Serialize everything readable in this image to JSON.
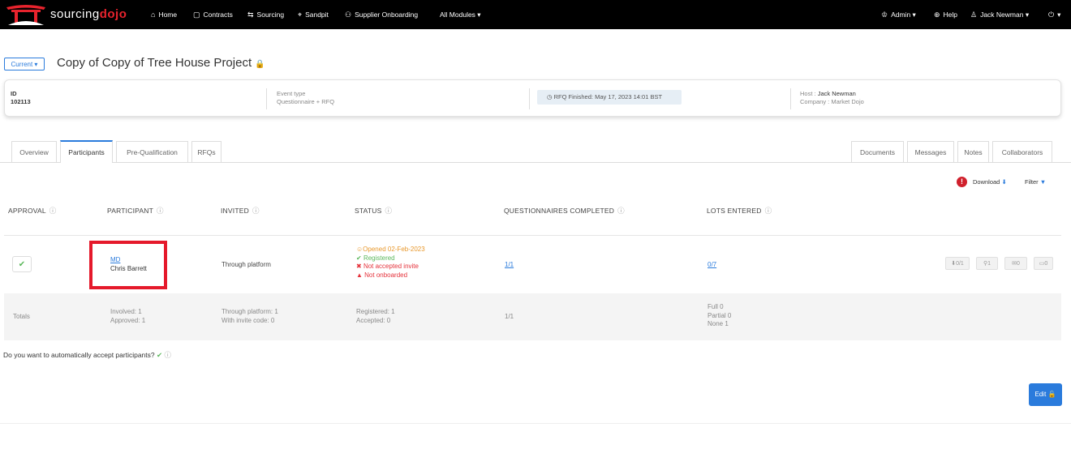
{
  "brand": {
    "part1": "sourcing",
    "part2": "dojo"
  },
  "nav": {
    "items": [
      {
        "icon": "home-icon",
        "glyph": "⌂",
        "label": "Home"
      },
      {
        "icon": "contracts-icon",
        "glyph": "▢",
        "label": "Contracts"
      },
      {
        "icon": "sourcing-icon",
        "glyph": "⇆",
        "label": "Sourcing"
      },
      {
        "icon": "sandpit-icon",
        "glyph": "⌖",
        "label": "Sandpit"
      },
      {
        "icon": "supplier-onboarding-icon",
        "glyph": "⚇",
        "label": "Supplier Onboarding"
      }
    ],
    "all_modules": "All Modules ▾",
    "admin": "Admin ▾",
    "help": "Help",
    "user": "Jack Newman ▾",
    "power": "▾"
  },
  "header": {
    "current_btn": "Current ▾",
    "title": "Copy of Copy of Tree House Project"
  },
  "info": {
    "id_label": "ID",
    "id_value": "102113",
    "event_type_label": "Event type",
    "event_type_value": "Questionnaire + RFQ",
    "rfq_status": "RFQ Finished: May 17, 2023 14:01 BST",
    "host_label": "Host : ",
    "host_value": "Jack Newman",
    "company_label": "Company : Market Dojo"
  },
  "tabs_left": [
    "Overview",
    "Participants",
    "Pre-Qualification",
    "RFQs"
  ],
  "tabs_right": [
    "Documents",
    "Messages",
    "Notes",
    "Collaborators"
  ],
  "toolbar": {
    "alert": "!",
    "download": "Download",
    "filter": "Filter"
  },
  "table": {
    "headers": [
      "APPROVAL",
      "PARTICIPANT",
      "INVITED",
      "STATUS",
      "QUESTIONNAIRES COMPLETED",
      "LOTS ENTERED"
    ],
    "row": {
      "participant_code": "MD",
      "participant_name": "Chris Barrett",
      "invited": "Through platform",
      "status": {
        "opened": "Opened 02-Feb-2023",
        "registered": "Registered",
        "not_accepted": "Not accepted invite",
        "not_onboarded": "Not onboarded"
      },
      "questionnaires": "1/1",
      "lots": "0/7",
      "actions": [
        "0/1",
        "1",
        "0",
        "0"
      ]
    },
    "totals": {
      "label": "Totals",
      "involved": "Involved: 1",
      "approved": "Approved: 1",
      "through_platform": "Through platform: 1",
      "invite_code": "With invite code: 0",
      "registered": "Registered: 1",
      "accepted": "Accepted: 0",
      "questionnaires": "1/1",
      "full": "Full 0",
      "partial": "Partial 0",
      "none": "None 1"
    }
  },
  "auto_accept": "Do you want to automatically accept participants?",
  "edit_label": "Edit",
  "colors": {
    "accent": "#2a7bdc",
    "nav_bg": "#000000",
    "danger": "#e5192b",
    "success": "#5cb85c",
    "warning": "#e8982c"
  }
}
